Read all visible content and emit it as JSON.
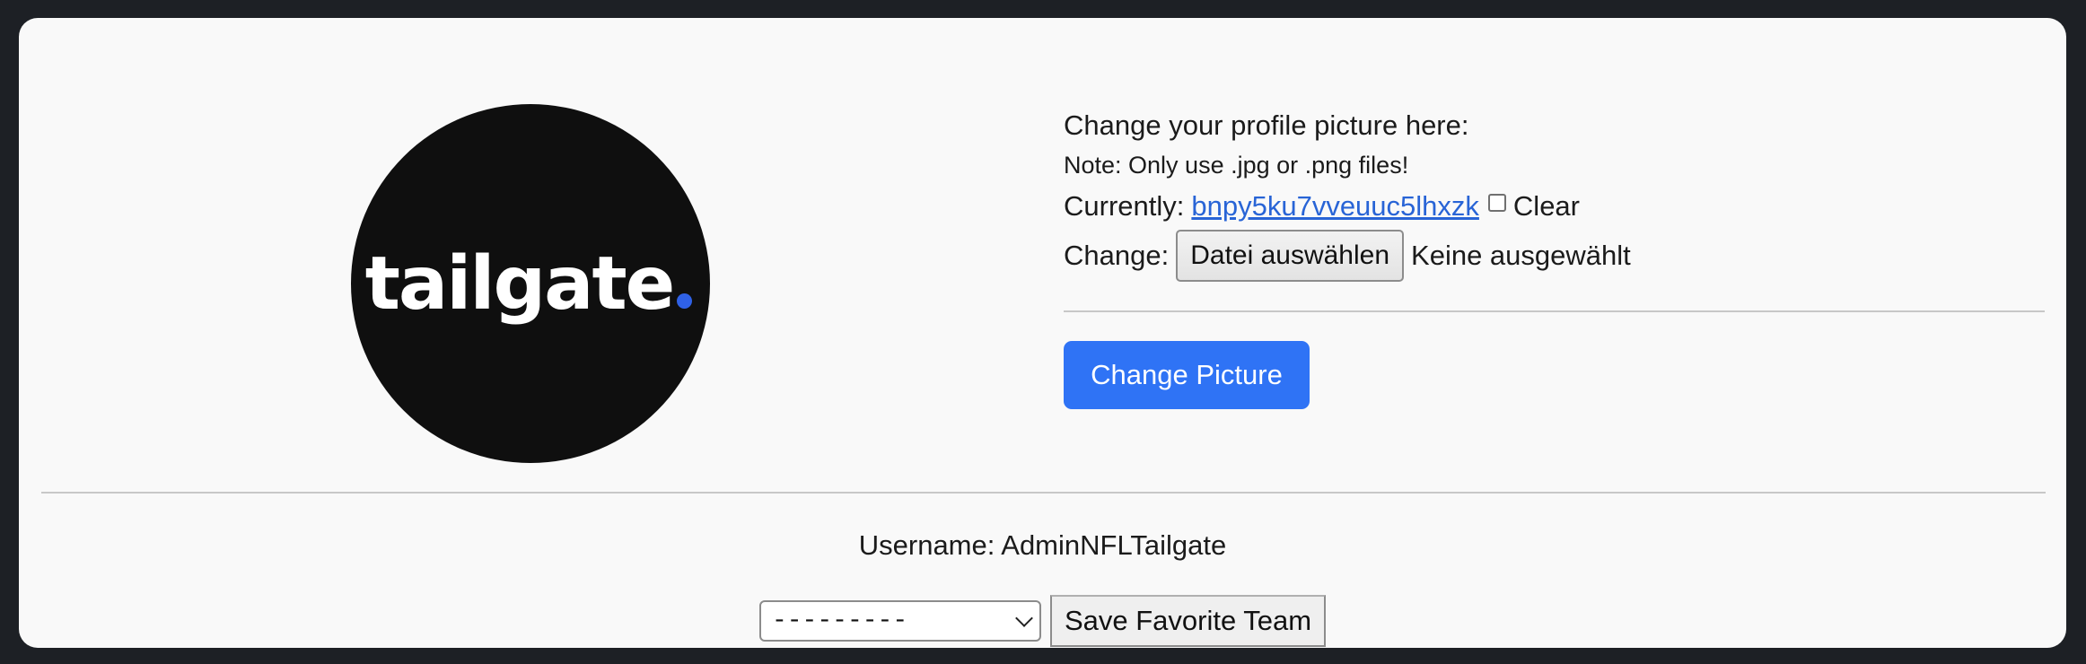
{
  "logo": {
    "text": "tailgate",
    "dot_color": "#2f61e6"
  },
  "profile_picture": {
    "heading": "Change your profile picture here:",
    "note": "Note: Only use .jpg or .png files!",
    "currently_label": "Currently:",
    "current_file": "bnpy5ku7vveuuc5lhxzk",
    "clear_label": "Clear",
    "clear_checked": false,
    "change_label": "Change:",
    "file_button_label": "Datei auswählen",
    "file_status": "Keine ausgewählt",
    "submit_label": "Change Picture",
    "submit_color": "#2f73f5"
  },
  "user": {
    "username_label": "Username:",
    "username": "AdminNFLTailgate"
  },
  "favorite_team": {
    "selected": "---------",
    "save_label": "Save Favorite Team"
  }
}
